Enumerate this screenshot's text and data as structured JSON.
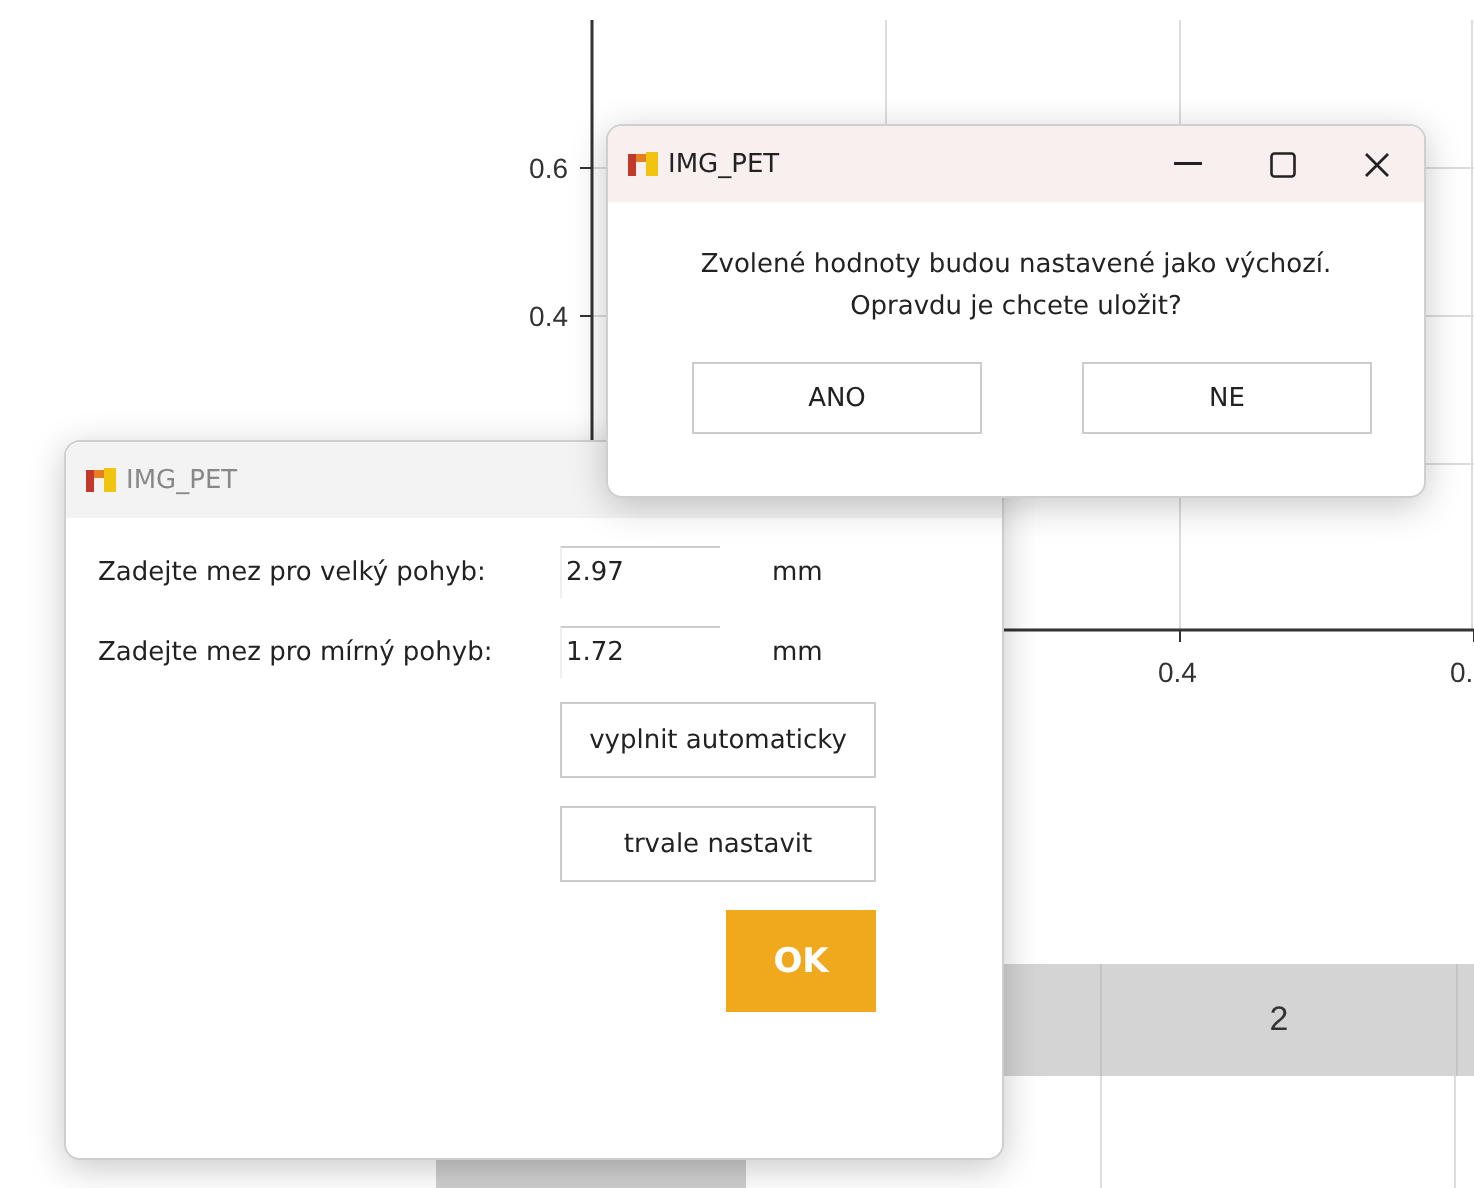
{
  "plot": {
    "y_ticks": [
      "0.6",
      "0.4"
    ],
    "x_ticks": [
      "0.4",
      "0."
    ]
  },
  "table": {
    "header_cells": [
      "2"
    ]
  },
  "settings_window": {
    "title": "IMG_PET",
    "active": false,
    "fields": [
      {
        "label": "Zadejte mez pro velký pohyb:",
        "value": "2.97",
        "unit": "mm"
      },
      {
        "label": "Zadejte mez pro mírný pohyb:",
        "value": "1.72",
        "unit": "mm"
      }
    ],
    "buttons": [
      {
        "label": "vyplnit automaticky",
        "kind": "plain"
      },
      {
        "label": "trvale nastavit",
        "kind": "plain"
      },
      {
        "label": "OK",
        "kind": "primary"
      }
    ]
  },
  "confirm_window": {
    "title": "IMG_PET",
    "active": true,
    "message": [
      "Zvolené hodnoty budou nastavené jako výchozí.",
      "Opravdu je chcete uložit?"
    ],
    "buttons": [
      "ANO",
      "NE"
    ]
  }
}
